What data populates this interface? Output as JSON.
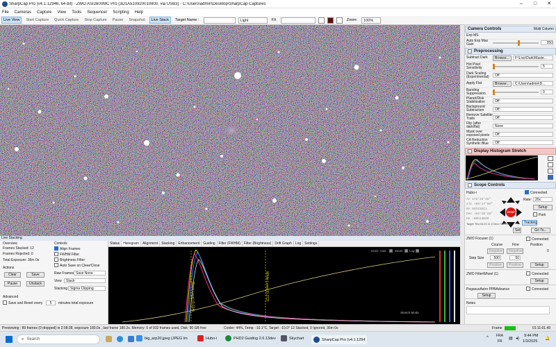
{
  "titlebar": {
    "title": "SharpCap Pro (v4.1.12946, 64 bit) - ZWO ASI2600MC Pro (3D1A510920010900, via USB3) - C:\\Users\\admin\\Desktop\\SharpCap Captures"
  },
  "menu": [
    "File",
    "Cameras",
    "Capture",
    "View",
    "Tools",
    "Sequencer",
    "Scripting",
    "Help"
  ],
  "toolbar": {
    "live_view": "Live View",
    "start_capture": "Start Capture",
    "quick_capture": "Quick Capture",
    "stop_capture": "Stop Capture",
    "pause": "Pause",
    "snapshot": "Snapshot",
    "live_stack": "Live Stack",
    "target_label": "Target Name :",
    "frame_type": "Light",
    "fx_label": "FX",
    "zoom_label": "Zoom:",
    "zoom_value": "100%"
  },
  "right_panel": {
    "camera_controls": "Camera Controls",
    "multi_column": "Multi Column",
    "exp_ms": "Exp MS",
    "auto_exp_max_gain": "Auto Exp Max Gain",
    "auto_exp_value": "350",
    "preprocessing": "Preprocessing",
    "subtract_dark": "Subtract Dark",
    "browse": "Browse...",
    "dark_path": "F:\\Live\\Dark\\Maste...",
    "hot_pixel": "Hot Pixel Sensitivity",
    "hot_pixel_value": "5",
    "dark_scaling": "Dark Scaling (Experimental)",
    "off": "Off",
    "apply_flat": "Apply Flat",
    "flat_path": "C:\\Users\\admin\\D...",
    "banding": "Banding Suppression",
    "banding_value": "0",
    "planet_disk": "Planet/Disk Stabilization",
    "bg_sub": "Background Subtraction",
    "remove_sat": "Remove Satellite Trails",
    "flip": "Flip (after dark/flat)",
    "none": "None",
    "mask": "Mask over exposed pixels",
    "ca_red": "CA Reduction Synthetic Blue",
    "display_hist": "Display Histogram Stretch",
    "scope_controls": "Scope Controls",
    "hubo": "Hubo-i",
    "connected": "Connected",
    "rate_label": "Rate:",
    "rate_value": "20x",
    "setup": "Setup",
    "park": "Park",
    "tracking": "Tracking",
    "stop": "STOP",
    "set": "Set",
    "goto": "Go To...",
    "az": "Az",
    "alt": "Alt",
    "ra": "RA",
    "dec": "Dec",
    "ha": "HA",
    "az_v": "178°26'48\"",
    "alt_v": "+69°17'06\"",
    "ra_v": "04h21m11",
    "dec_v": "+52°20'28\"",
    "ha_v": "-00h13m09",
    "target_text": "Target: RA=04:21:11.0 Dec=+52:20:28",
    "zwo_focuser": "ZWO Focuser (1)",
    "course": "Course",
    "fine": "Fine",
    "position": "Position",
    "negative": "Negative",
    "positive": "Positive",
    "step_size": "Step Size",
    "step_course": "500",
    "step_fine": "50",
    "pos_value": "0",
    "zwo_filter": "ZWO FilterWheel (1)",
    "pegasus": "PegasusAstro PPBAdvance",
    "notes": "Notes"
  },
  "live_stacking": {
    "header": "Live Stacking",
    "overview": "Overview",
    "frames_stacked": "Frames Stacked:  12",
    "frames_rejected": "Frames Rejected: 0",
    "total_exposure": "Total Exposure:  36m 0s",
    "actions": "Actions",
    "clear": "Clear",
    "save": "Save",
    "pause": "Pause",
    "unstack": "Unstack",
    "advanced": "Advanced",
    "save_reset": "Save and Reset every",
    "save_reset_val": "5",
    "minutes_total": "minutes total exposure",
    "controls": "Controls",
    "align_frames": "Align Frames",
    "fwhm_filter": "FWHM Filter",
    "brightness_filter": "Brightness Filter",
    "auto_save": "Auto Save on Clear/Close",
    "raw_frames": "Raw Frames",
    "raw_value": "Save None",
    "view": "View",
    "view_value": "Stack",
    "stacking": "Stacking",
    "stacking_value": "Sigma Clipping"
  },
  "tabs": [
    "Status",
    "Histogram",
    "Alignment",
    "Stacking",
    "Enhancement",
    "Guiding",
    "Filter (FWHM)",
    "Filter (Brightness)",
    "Drift Graph",
    "Log",
    "Settings"
  ],
  "histogram": {
    "horiz_axis": "Horiz. Axis",
    "zoom": "Zoom",
    "log": "Log",
    "stretch_mode": "Stretch Mode",
    "black_level": "Black Level (0.024)",
    "white_level": "White Level (0.272)"
  },
  "statusbar": {
    "text": "Previewing : 89 frames (0 dropped) in 2:08:28, exposure 180.0s , last frame 180.2s. Memory: 5 of 932 frames used, Disk: 90 GB free",
    "cooler": "Cooler: 44%, Temp: -10.1°C, Target: -10.0°  12 Stacked, 0 Ignored, 36m 0s",
    "frame": "Frame",
    "time": "01:11:01.49"
  },
  "taskbar": {
    "search": "Search",
    "items": [
      "big_arp20.jpeg (JPEG Im",
      "Hubo-i",
      "PHD2 Guiding 2.6.13dev",
      "Skychart",
      "SharpCap Pro (v4.1.1294"
    ],
    "lang1": "FRA",
    "lang2": "FR",
    "clock_time": "9:44 PM",
    "clock_date": "1/3/2025"
  }
}
